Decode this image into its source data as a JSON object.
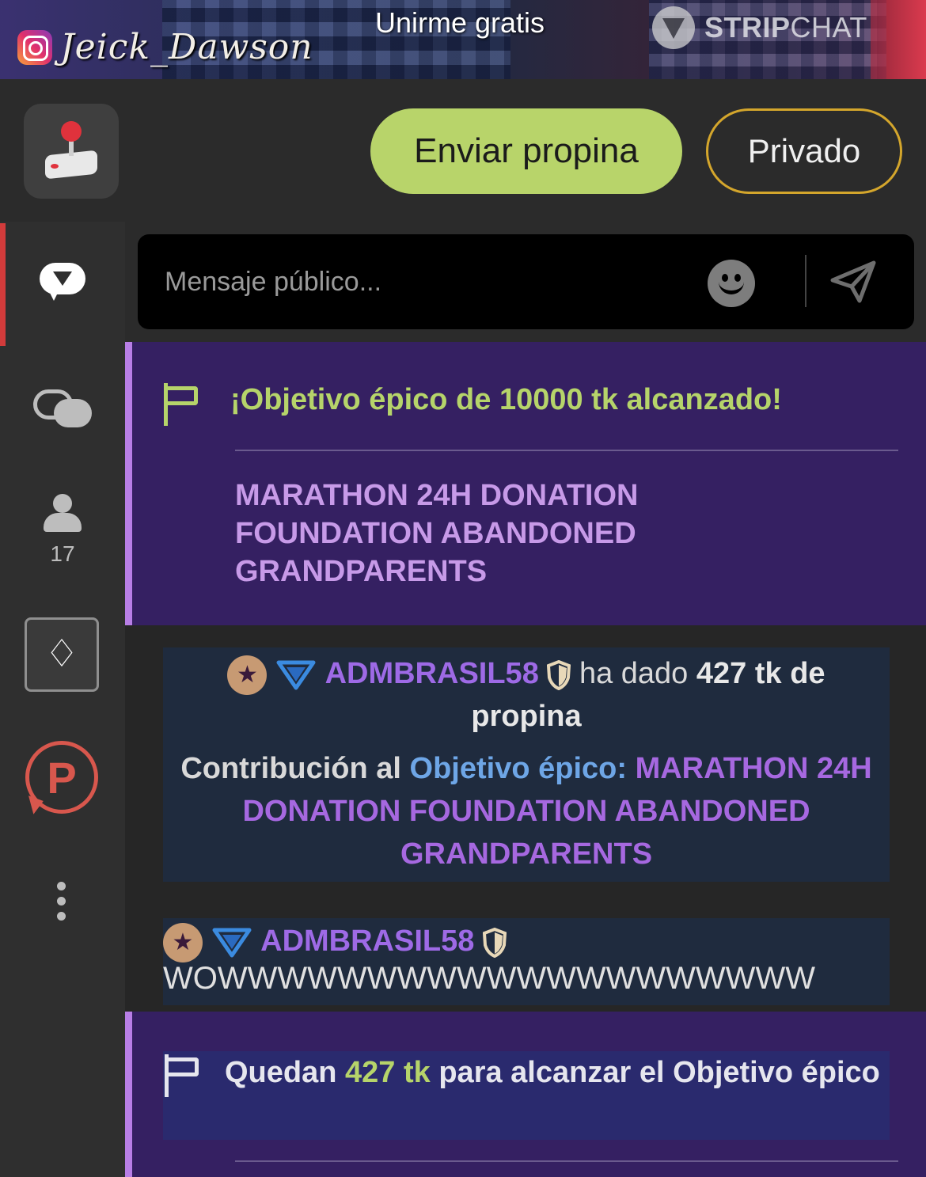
{
  "video": {
    "instagram_handle": "Jeick_Dawson",
    "join_label": "Unirme gratis",
    "brand_bold": "STRIP",
    "brand_light": "CHAT"
  },
  "actions": {
    "tip_label": "Enviar propina",
    "private_label": "Privado"
  },
  "sidebar": {
    "viewer_count": "17",
    "icons": [
      "joystick-icon",
      "chat-bubble-icon",
      "chats-icon",
      "user-icon",
      "diamond-icon",
      "p-icon",
      "more-icon"
    ]
  },
  "composer": {
    "placeholder": "Mensaje público..."
  },
  "chat": {
    "goal_reached": {
      "title": "¡Objetivo épico de 10000 tk alcanzado!",
      "goal_name": "MARATHON 24H DONATION FOUNDATION ABANDONED GRANDPARENTS"
    },
    "tip": {
      "username": "ADMBRASIL58",
      "prefix": "ha dado",
      "amount": "427 tk de",
      "suffix": "propina",
      "contrib_label": "Contribución al",
      "contrib_link": "Objetivo épico:",
      "contrib_goal": "MARATHON 24H DONATION FOUNDATION ABANDONED GRANDPARENTS"
    },
    "message": {
      "username": "ADMBRASIL58",
      "text": "WOWWWWWWWWWWWWWWWWWWWW"
    },
    "goal_remaining": {
      "prefix": "Quedan",
      "amount": "427 tk",
      "suffix": "para alcanzar el Objetivo épico"
    }
  },
  "colors": {
    "tip_button": "#b8d46a",
    "private_border": "#d4a62c",
    "goal_bg": "#352062",
    "goal_accent": "#b87ee6",
    "username": "#9e6ae6",
    "green": "#b6d46a",
    "link_blue": "#6ea6e6"
  }
}
